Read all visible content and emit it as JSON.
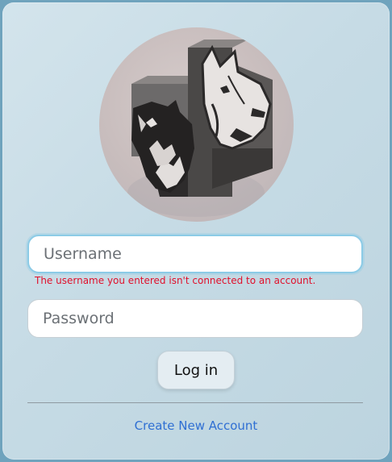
{
  "login": {
    "username_placeholder": "Username",
    "username_value": "",
    "error_message": "The username you entered isn't connected to an account.",
    "password_placeholder": "Password",
    "password_value": "",
    "login_label": "Log in",
    "create_account_label": "Create New Account"
  },
  "colors": {
    "error": "#e0102b",
    "link": "#2f6fd3",
    "focus_ring": "#8ccbe6"
  }
}
